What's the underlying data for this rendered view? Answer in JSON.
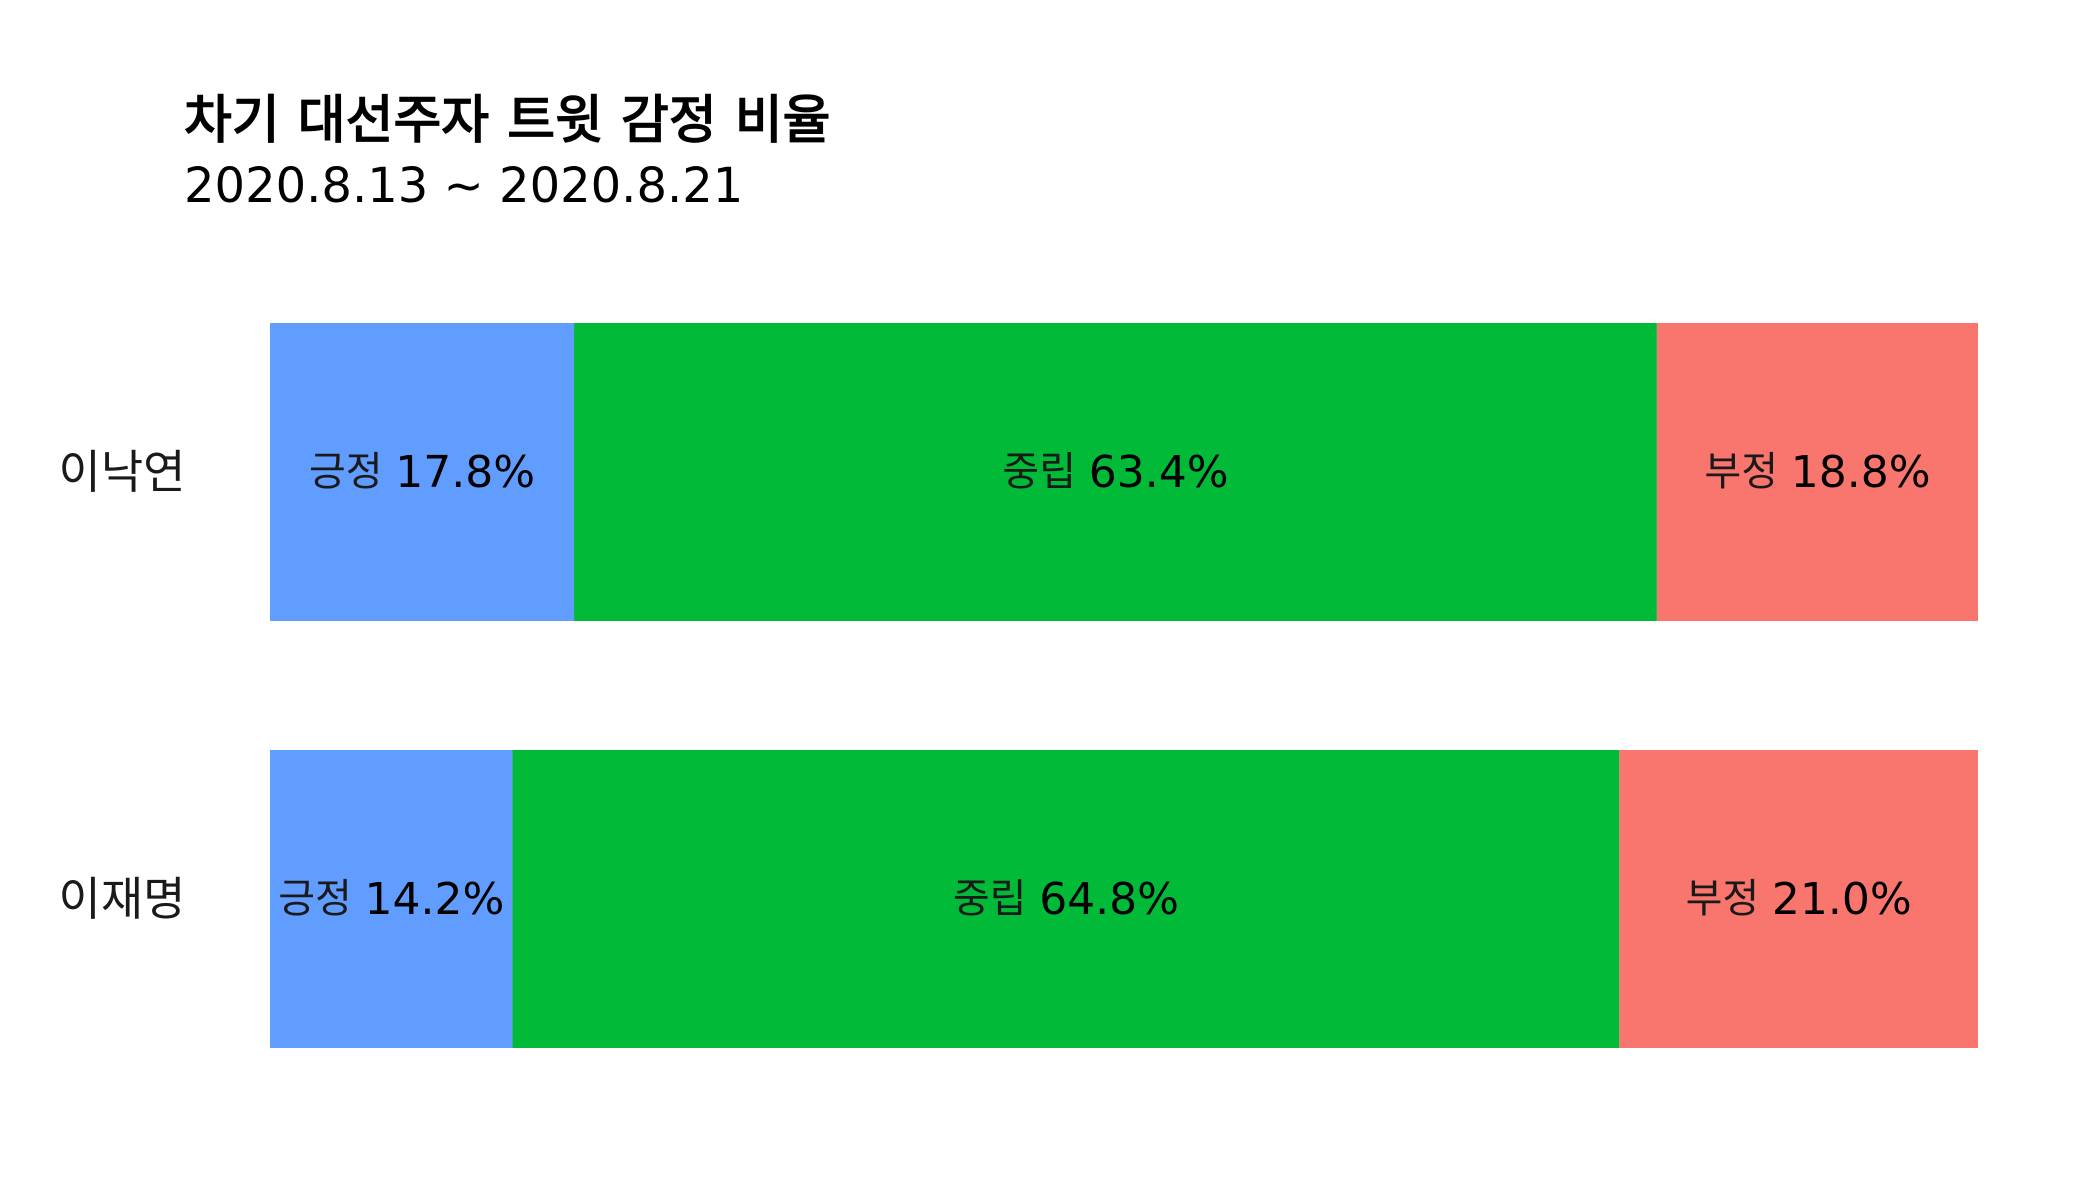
{
  "chart_data": {
    "type": "bar",
    "orientation": "horizontal",
    "stacked": true,
    "title": "차기 대선주자 트윗 감정 비율",
    "subtitle": "2020.8.13 ~ 2020.8.21",
    "categories": [
      "이낙연",
      "이재명"
    ],
    "series": [
      {
        "name": "긍정",
        "color": "#619CFF",
        "values": [
          17.8,
          14.2
        ],
        "labels": [
          "17.8%",
          "14.2%"
        ]
      },
      {
        "name": "중립",
        "color": "#00BA38",
        "values": [
          63.4,
          64.8
        ],
        "labels": [
          "63.4%",
          "64.8%"
        ]
      },
      {
        "name": "부정",
        "color": "#F8766D",
        "values": [
          18.8,
          21.0
        ],
        "labels": [
          "18.8%",
          "21.0%"
        ]
      }
    ],
    "xlim": [
      0,
      100
    ],
    "grid": false,
    "legend": "none"
  }
}
